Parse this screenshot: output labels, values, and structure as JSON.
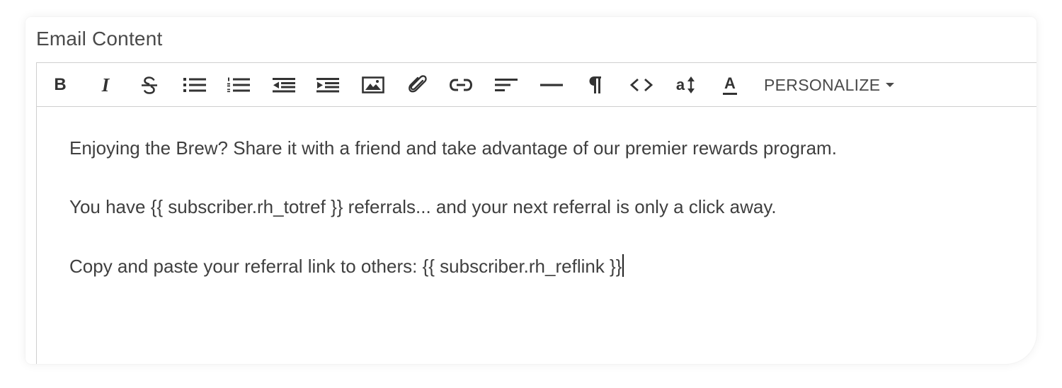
{
  "section": {
    "title": "Email Content"
  },
  "toolbar": {
    "bold_label": "B",
    "italic_label": "I",
    "font_size_label": "a",
    "font_color_label": "A",
    "personalize_label": "PERSONALIZE",
    "icons": [
      "bold-icon",
      "italic-icon",
      "strikethrough-icon",
      "bullet-list-icon",
      "numbered-list-icon",
      "outdent-icon",
      "indent-icon",
      "image-icon",
      "attachment-icon",
      "link-icon",
      "align-left-icon",
      "horizontal-rule-icon",
      "paragraph-icon",
      "code-icon",
      "font-size-icon",
      "font-color-icon",
      "chevron-down-icon"
    ]
  },
  "body": {
    "paragraphs": [
      "Enjoying the Brew? Share it with a friend and take advantage of our premier rewards program.",
      "You have {{ subscriber.rh_totref }} referrals... and your next referral is only a click away.",
      "Copy and paste your referral link to others: {{ subscriber.rh_reflink }}"
    ]
  }
}
